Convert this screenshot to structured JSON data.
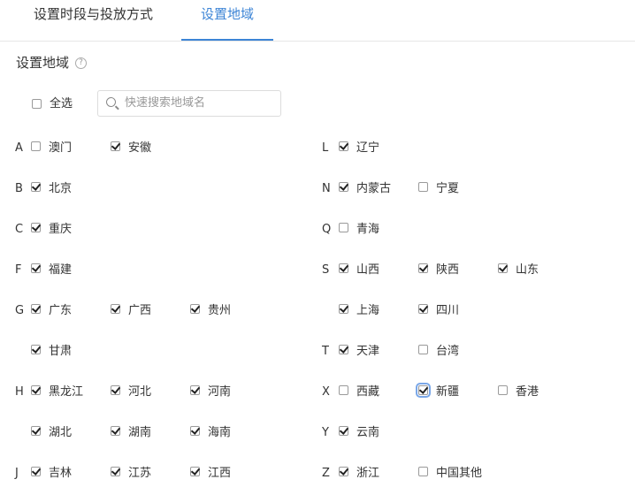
{
  "tabs": [
    {
      "label": "设置时段与投放方式",
      "active": false
    },
    {
      "label": "设置地域",
      "active": true
    }
  ],
  "section_title": "设置地域",
  "help_icon": "?",
  "select_all": {
    "label": "全选",
    "checked": false
  },
  "search": {
    "placeholder": "快速搜索地域名",
    "value": ""
  },
  "regions": [
    {
      "letter": "A",
      "items": [
        {
          "name": "澳门",
          "checked": false
        },
        {
          "name": "安徽",
          "checked": true
        }
      ]
    },
    {
      "letter": "B",
      "items": [
        {
          "name": "北京",
          "checked": true
        }
      ]
    },
    {
      "letter": "C",
      "items": [
        {
          "name": "重庆",
          "checked": true
        }
      ]
    },
    {
      "letter": "F",
      "items": [
        {
          "name": "福建",
          "checked": true
        }
      ]
    },
    {
      "letter": "G",
      "items": [
        {
          "name": "广东",
          "checked": true
        },
        {
          "name": "广西",
          "checked": true
        },
        {
          "name": "贵州",
          "checked": true
        }
      ]
    },
    {
      "letter": "",
      "items": [
        {
          "name": "甘肃",
          "checked": true
        }
      ]
    },
    {
      "letter": "H",
      "items": [
        {
          "name": "黑龙江",
          "checked": true
        },
        {
          "name": "河北",
          "checked": true
        },
        {
          "name": "河南",
          "checked": true
        }
      ]
    },
    {
      "letter": "",
      "items": [
        {
          "name": "湖北",
          "checked": true
        },
        {
          "name": "湖南",
          "checked": true
        },
        {
          "name": "海南",
          "checked": true
        }
      ]
    },
    {
      "letter": "J",
      "items": [
        {
          "name": "吉林",
          "checked": true
        },
        {
          "name": "江苏",
          "checked": true
        },
        {
          "name": "江西",
          "checked": true
        }
      ]
    },
    {
      "letter": "L",
      "items": [
        {
          "name": "辽宁",
          "checked": true
        }
      ]
    },
    {
      "letter": "N",
      "items": [
        {
          "name": "内蒙古",
          "checked": true
        },
        {
          "name": "宁夏",
          "checked": false
        }
      ]
    },
    {
      "letter": "Q",
      "items": [
        {
          "name": "青海",
          "checked": false
        }
      ]
    },
    {
      "letter": "S",
      "items": [
        {
          "name": "山西",
          "checked": true
        },
        {
          "name": "陕西",
          "checked": true
        },
        {
          "name": "山东",
          "checked": true
        }
      ]
    },
    {
      "letter": "",
      "items": [
        {
          "name": "上海",
          "checked": true
        },
        {
          "name": "四川",
          "checked": true
        }
      ]
    },
    {
      "letter": "T",
      "items": [
        {
          "name": "天津",
          "checked": true
        },
        {
          "name": "台湾",
          "checked": false
        }
      ]
    },
    {
      "letter": "X",
      "items": [
        {
          "name": "西藏",
          "checked": false
        },
        {
          "name": "新疆",
          "checked": true
        },
        {
          "name": "香港",
          "checked": false
        }
      ]
    },
    {
      "letter": "Y",
      "items": [
        {
          "name": "云南",
          "checked": true
        }
      ]
    },
    {
      "letter": "Z",
      "items": [
        {
          "name": "浙江",
          "checked": true
        },
        {
          "name": "中国其他",
          "checked": false
        }
      ]
    }
  ]
}
